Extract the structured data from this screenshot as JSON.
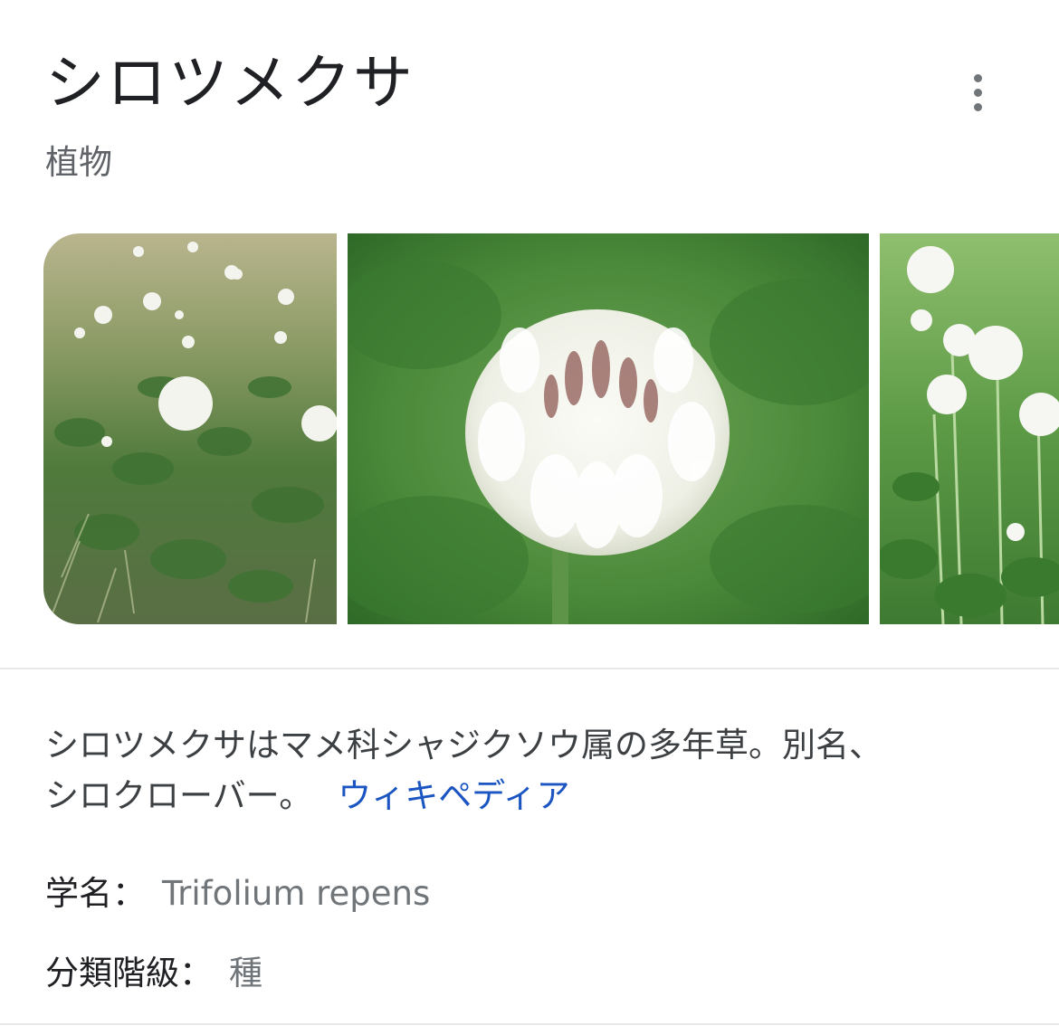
{
  "panel": {
    "title": "シロツメクサ",
    "subtitle": "植物",
    "menu_icon": "more-vert-icon"
  },
  "images": [
    {
      "kind": "meadow-photo"
    },
    {
      "kind": "flower-closeup-photo"
    },
    {
      "kind": "clover-field-photo"
    }
  ],
  "description": {
    "line1": "シロツメクサはマメ科シャジクソウ属の多年草。別名、",
    "line2": "シロクローバー。",
    "source_link": "ウィキペディア"
  },
  "facts": [
    {
      "label": "学名：",
      "value": "Trifolium repens"
    },
    {
      "label": "分類階級：",
      "value": "種"
    }
  ],
  "colors": {
    "link": "#1a55c2",
    "secondary_text": "#70757a",
    "divider": "#e8e8e8"
  }
}
